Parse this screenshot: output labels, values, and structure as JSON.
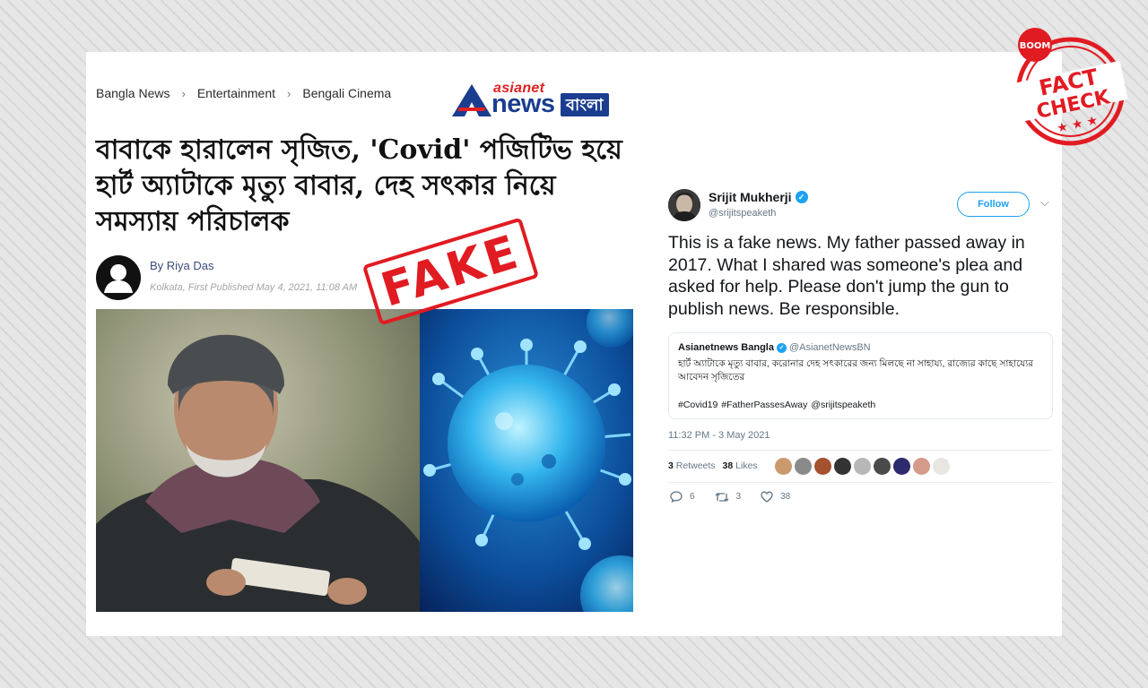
{
  "breadcrumb": {
    "items": [
      "Bangla News",
      "Entertainment",
      "Bengali Cinema"
    ],
    "separator": "›"
  },
  "logo": {
    "top": "asianet",
    "news": "news",
    "bangla": "বাংলা"
  },
  "article": {
    "headline": "বাবাকে হারালেন সৃজিত, 'Covid' পজিটিভ হয়ে হার্ট অ্যাটাকে মৃত্যু বাবার, দেহ সৎকার নিয়ে সমস্যায় পরিচালক",
    "author": "By Riya Das",
    "meta": "Kolkata, First Published May 4, 2021, 11:08 AM"
  },
  "stamps": {
    "fake": "FAKE",
    "boom": "BOOM",
    "fact": "FACT",
    "check": "CHECK"
  },
  "tweet": {
    "name": "Srijit Mukherji",
    "handle": "@srijitspeaketh",
    "follow_label": "Follow",
    "text": "This is a fake news. My father passed away in 2017. What I shared was someone's plea and asked for help. Please don't jump the gun to publish news. Be responsible.",
    "quoted": {
      "name": "Asianetnews Bangla",
      "handle": "@AsianetNewsBN",
      "text": "হার্ট অ্যাটাকে মৃত্যু বাবার, করোনার দেহ সৎকারের জন্য মিলছে না সাহায্য, রাজ্যের কাছে সাহায্যের আবেদন সৃজিতের",
      "tags": "#Covid19  #FatherPassesAway  @srijitspeaketh"
    },
    "time": "11:32 PM - 3 May 2021",
    "retweets_count": "3",
    "retweets_label": "Retweets",
    "likes_count": "38",
    "likes_label": "Likes",
    "actions": {
      "reply": "6",
      "retweet": "3",
      "like": "38"
    }
  },
  "colors": {
    "accent_red": "#e11b22",
    "twitter_blue": "#1da1f2",
    "brand_blue": "#1a3d8f"
  }
}
